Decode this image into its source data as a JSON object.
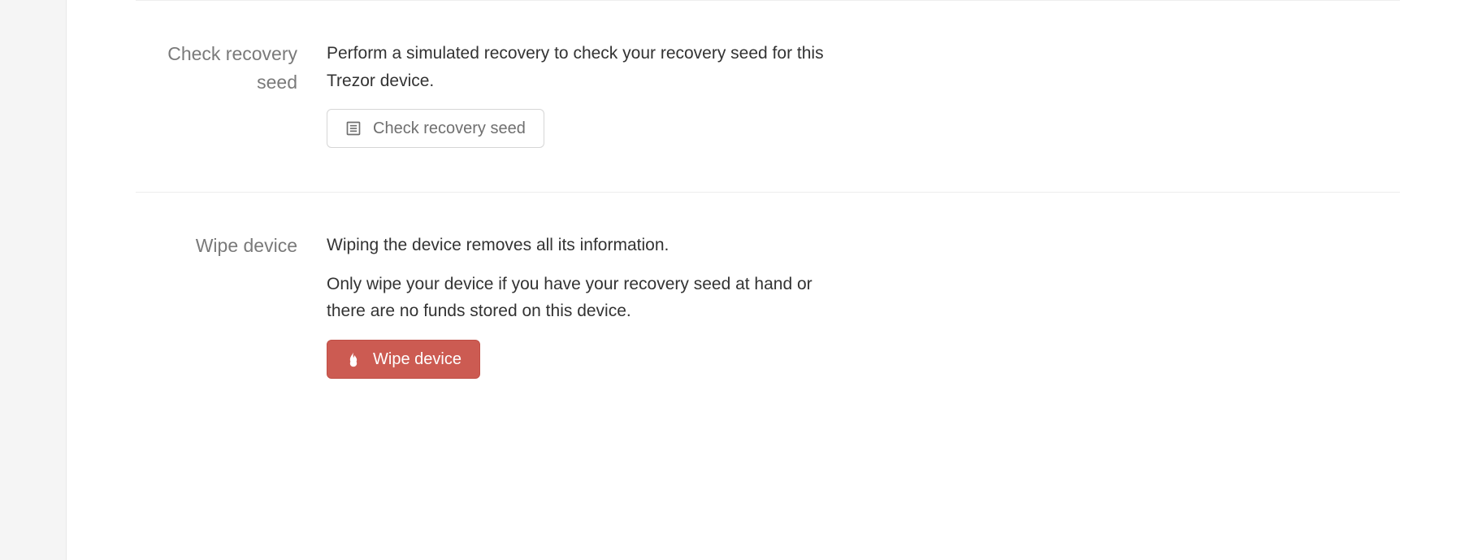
{
  "sections": {
    "check_seed": {
      "label": "Check recovery seed",
      "description": "Perform a simulated recovery to check your recovery seed for this Trezor device.",
      "button_label": "Check recovery seed"
    },
    "wipe": {
      "label": "Wipe device",
      "description1": "Wiping the device removes all its information.",
      "description2": "Only wipe your device if you have your recovery seed at hand or there are no funds stored on this device.",
      "button_label": "Wipe device"
    }
  },
  "colors": {
    "danger": "#cc5b52",
    "text_muted": "#7a7a7a",
    "text": "#333333",
    "border": "#eeeeee"
  }
}
